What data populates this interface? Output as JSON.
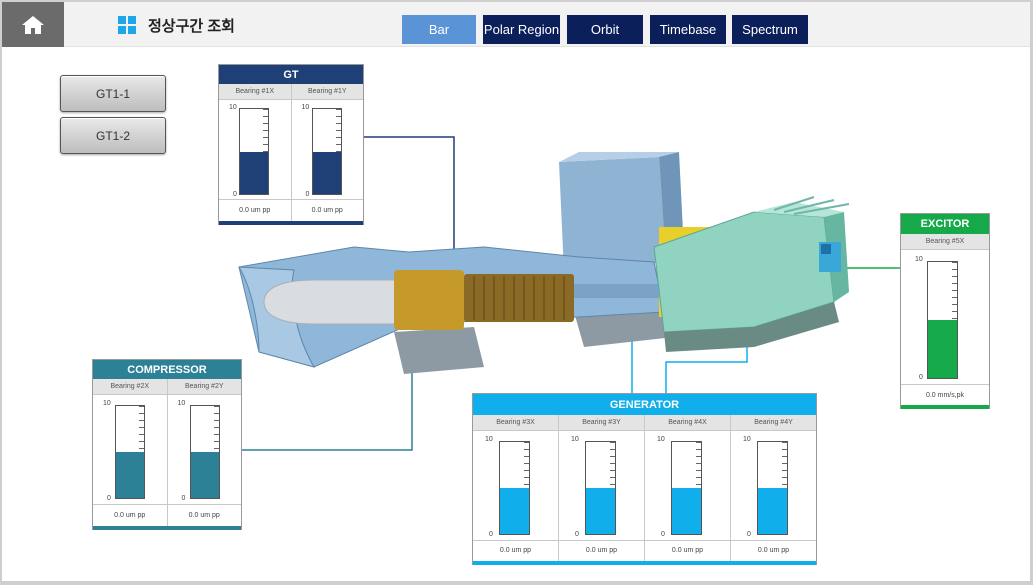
{
  "header": {
    "home_icon": "home-icon",
    "title": "정상구간 조회",
    "tabs": [
      {
        "label": "Bar",
        "active": true
      },
      {
        "label": "Polar Region",
        "active": false
      },
      {
        "label": "Orbit",
        "active": false
      },
      {
        "label": "Timebase",
        "active": false
      },
      {
        "label": "Spectrum",
        "active": false
      }
    ]
  },
  "units": [
    {
      "label": "GT1-1"
    },
    {
      "label": "GT1-2"
    }
  ],
  "panels": {
    "gt": {
      "title": "GT",
      "color": "#1f3f77",
      "bearings": [
        {
          "label": "Bearing #1X",
          "max": "10",
          "min": "0",
          "level": 0.5,
          "value": "0.0 um pp"
        },
        {
          "label": "Bearing #1Y",
          "max": "10",
          "min": "0",
          "level": 0.5,
          "value": "0.0 um pp"
        }
      ]
    },
    "compressor": {
      "title": "COMPRESSOR",
      "color": "#2c8197",
      "bearings": [
        {
          "label": "Bearing #2X",
          "max": "10",
          "min": "0",
          "level": 0.5,
          "value": "0.0 um pp"
        },
        {
          "label": "Bearing #2Y",
          "max": "10",
          "min": "0",
          "level": 0.5,
          "value": "0.0 um pp"
        }
      ]
    },
    "generator": {
      "title": "GENERATOR",
      "color": "#10aeea",
      "bearings": [
        {
          "label": "Bearing #3X",
          "max": "10",
          "min": "0",
          "level": 0.5,
          "value": "0.0 um pp"
        },
        {
          "label": "Bearing #3Y",
          "max": "10",
          "min": "0",
          "level": 0.5,
          "value": "0.0 um pp"
        },
        {
          "label": "Bearing #4X",
          "max": "10",
          "min": "0",
          "level": 0.5,
          "value": "0.0 um pp"
        },
        {
          "label": "Bearing #4Y",
          "max": "10",
          "min": "0",
          "level": 0.5,
          "value": "0.0 um pp"
        }
      ]
    },
    "exciter": {
      "title": "EXCITOR",
      "color": "#16a94a",
      "bearings": [
        {
          "label": "Bearing #5X",
          "max": "10",
          "min": "0",
          "level": 0.5,
          "value": "0.0 mm/s,pk"
        }
      ]
    }
  }
}
